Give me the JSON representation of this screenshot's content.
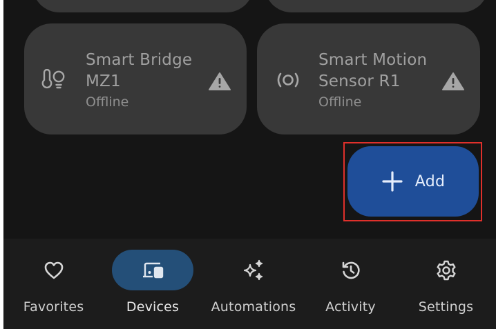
{
  "devices": [
    {
      "name_line1": "Smart Bridge",
      "name_line2": "MZ1",
      "status": "Offline",
      "icon": "bridge-icon",
      "warning_icon": "warning-icon"
    },
    {
      "name_line1": "Smart Motion",
      "name_line2": "Sensor R1",
      "status": "Offline",
      "icon": "motion-sensor-icon",
      "warning_icon": "warning-icon"
    }
  ],
  "add_button": {
    "label": "Add",
    "icon": "plus-icon"
  },
  "bottom_nav": {
    "active": "Devices",
    "items": [
      {
        "label": "Favorites",
        "icon": "heart-icon"
      },
      {
        "label": "Devices",
        "icon": "devices-icon"
      },
      {
        "label": "Automations",
        "icon": "sparkle-icon"
      },
      {
        "label": "Activity",
        "icon": "history-icon"
      },
      {
        "label": "Settings",
        "icon": "gear-icon"
      }
    ]
  },
  "colors": {
    "background": "#151515",
    "card": "#383838",
    "accent": "#1f4e99",
    "nav_active": "#244f78",
    "highlight": "#e0302b"
  }
}
